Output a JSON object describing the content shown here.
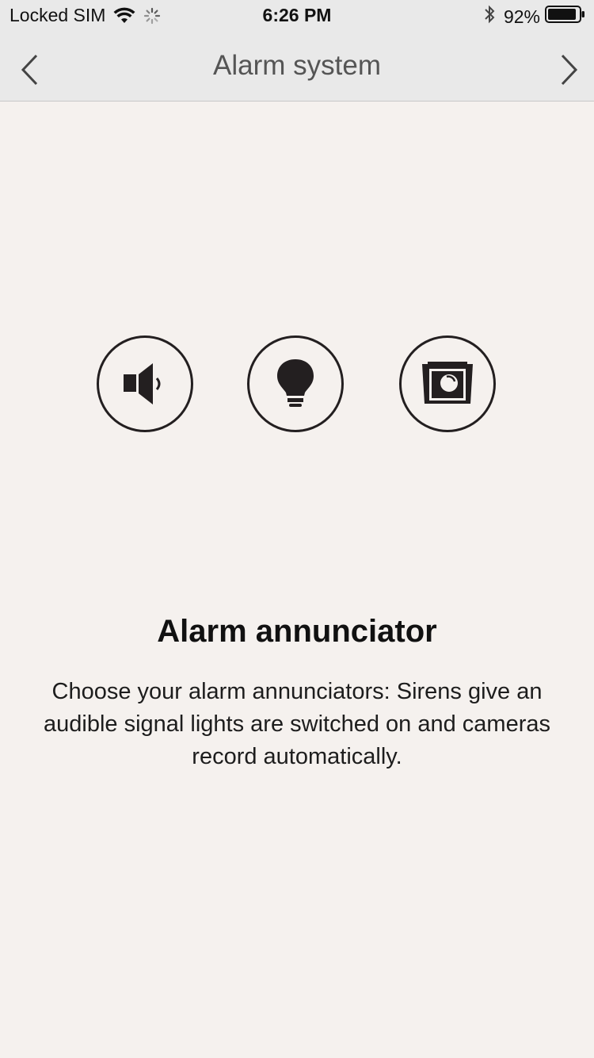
{
  "status_bar": {
    "carrier": "Locked SIM",
    "time": "6:26 PM",
    "battery_percent": "92%",
    "battery_level": 0.92
  },
  "nav": {
    "title": "Alarm system"
  },
  "annunciators": {
    "icons": [
      "siren-icon",
      "light-bulb-icon",
      "camera-icon"
    ]
  },
  "content": {
    "title": "Alarm annunciator",
    "description": "Choose your alarm annunciators: Sirens give an audible signal lights are switched on and cameras record automatically."
  },
  "colors": {
    "background": "#f5f1ee",
    "header": "#e9e9e9",
    "icon": "#231f20"
  }
}
